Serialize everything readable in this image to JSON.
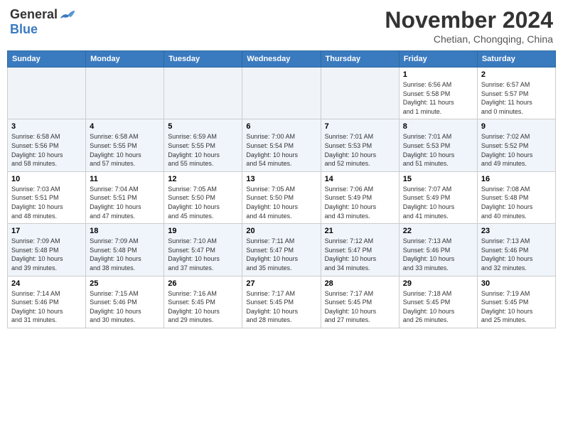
{
  "header": {
    "logo_general": "General",
    "logo_blue": "Blue",
    "month": "November 2024",
    "location": "Chetian, Chongqing, China"
  },
  "weekdays": [
    "Sunday",
    "Monday",
    "Tuesday",
    "Wednesday",
    "Thursday",
    "Friday",
    "Saturday"
  ],
  "weeks": [
    [
      {
        "day": "",
        "info": ""
      },
      {
        "day": "",
        "info": ""
      },
      {
        "day": "",
        "info": ""
      },
      {
        "day": "",
        "info": ""
      },
      {
        "day": "",
        "info": ""
      },
      {
        "day": "1",
        "info": "Sunrise: 6:56 AM\nSunset: 5:58 PM\nDaylight: 11 hours\nand 1 minute."
      },
      {
        "day": "2",
        "info": "Sunrise: 6:57 AM\nSunset: 5:57 PM\nDaylight: 11 hours\nand 0 minutes."
      }
    ],
    [
      {
        "day": "3",
        "info": "Sunrise: 6:58 AM\nSunset: 5:56 PM\nDaylight: 10 hours\nand 58 minutes."
      },
      {
        "day": "4",
        "info": "Sunrise: 6:58 AM\nSunset: 5:55 PM\nDaylight: 10 hours\nand 57 minutes."
      },
      {
        "day": "5",
        "info": "Sunrise: 6:59 AM\nSunset: 5:55 PM\nDaylight: 10 hours\nand 55 minutes."
      },
      {
        "day": "6",
        "info": "Sunrise: 7:00 AM\nSunset: 5:54 PM\nDaylight: 10 hours\nand 54 minutes."
      },
      {
        "day": "7",
        "info": "Sunrise: 7:01 AM\nSunset: 5:53 PM\nDaylight: 10 hours\nand 52 minutes."
      },
      {
        "day": "8",
        "info": "Sunrise: 7:01 AM\nSunset: 5:53 PM\nDaylight: 10 hours\nand 51 minutes."
      },
      {
        "day": "9",
        "info": "Sunrise: 7:02 AM\nSunset: 5:52 PM\nDaylight: 10 hours\nand 49 minutes."
      }
    ],
    [
      {
        "day": "10",
        "info": "Sunrise: 7:03 AM\nSunset: 5:51 PM\nDaylight: 10 hours\nand 48 minutes."
      },
      {
        "day": "11",
        "info": "Sunrise: 7:04 AM\nSunset: 5:51 PM\nDaylight: 10 hours\nand 47 minutes."
      },
      {
        "day": "12",
        "info": "Sunrise: 7:05 AM\nSunset: 5:50 PM\nDaylight: 10 hours\nand 45 minutes."
      },
      {
        "day": "13",
        "info": "Sunrise: 7:05 AM\nSunset: 5:50 PM\nDaylight: 10 hours\nand 44 minutes."
      },
      {
        "day": "14",
        "info": "Sunrise: 7:06 AM\nSunset: 5:49 PM\nDaylight: 10 hours\nand 43 minutes."
      },
      {
        "day": "15",
        "info": "Sunrise: 7:07 AM\nSunset: 5:49 PM\nDaylight: 10 hours\nand 41 minutes."
      },
      {
        "day": "16",
        "info": "Sunrise: 7:08 AM\nSunset: 5:48 PM\nDaylight: 10 hours\nand 40 minutes."
      }
    ],
    [
      {
        "day": "17",
        "info": "Sunrise: 7:09 AM\nSunset: 5:48 PM\nDaylight: 10 hours\nand 39 minutes."
      },
      {
        "day": "18",
        "info": "Sunrise: 7:09 AM\nSunset: 5:48 PM\nDaylight: 10 hours\nand 38 minutes."
      },
      {
        "day": "19",
        "info": "Sunrise: 7:10 AM\nSunset: 5:47 PM\nDaylight: 10 hours\nand 37 minutes."
      },
      {
        "day": "20",
        "info": "Sunrise: 7:11 AM\nSunset: 5:47 PM\nDaylight: 10 hours\nand 35 minutes."
      },
      {
        "day": "21",
        "info": "Sunrise: 7:12 AM\nSunset: 5:47 PM\nDaylight: 10 hours\nand 34 minutes."
      },
      {
        "day": "22",
        "info": "Sunrise: 7:13 AM\nSunset: 5:46 PM\nDaylight: 10 hours\nand 33 minutes."
      },
      {
        "day": "23",
        "info": "Sunrise: 7:13 AM\nSunset: 5:46 PM\nDaylight: 10 hours\nand 32 minutes."
      }
    ],
    [
      {
        "day": "24",
        "info": "Sunrise: 7:14 AM\nSunset: 5:46 PM\nDaylight: 10 hours\nand 31 minutes."
      },
      {
        "day": "25",
        "info": "Sunrise: 7:15 AM\nSunset: 5:46 PM\nDaylight: 10 hours\nand 30 minutes."
      },
      {
        "day": "26",
        "info": "Sunrise: 7:16 AM\nSunset: 5:45 PM\nDaylight: 10 hours\nand 29 minutes."
      },
      {
        "day": "27",
        "info": "Sunrise: 7:17 AM\nSunset: 5:45 PM\nDaylight: 10 hours\nand 28 minutes."
      },
      {
        "day": "28",
        "info": "Sunrise: 7:17 AM\nSunset: 5:45 PM\nDaylight: 10 hours\nand 27 minutes."
      },
      {
        "day": "29",
        "info": "Sunrise: 7:18 AM\nSunset: 5:45 PM\nDaylight: 10 hours\nand 26 minutes."
      },
      {
        "day": "30",
        "info": "Sunrise: 7:19 AM\nSunset: 5:45 PM\nDaylight: 10 hours\nand 25 minutes."
      }
    ]
  ]
}
